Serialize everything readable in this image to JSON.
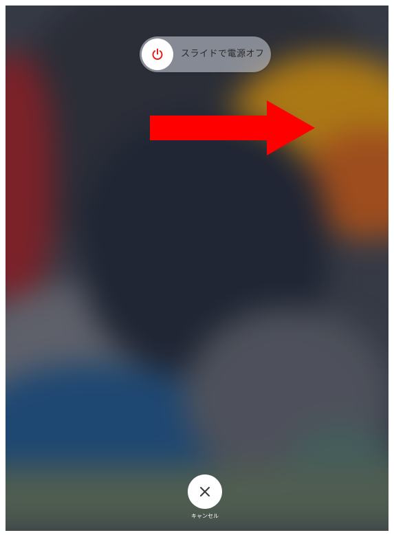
{
  "power_slider": {
    "label": "スライドで電源オフ",
    "knob_icon": "power-icon",
    "knob_icon_color": "#e0201c"
  },
  "annotation": {
    "arrow_icon": "right-arrow-icon",
    "arrow_color": "#ff0000"
  },
  "cancel": {
    "icon": "close-icon",
    "label": "キャンセル"
  }
}
